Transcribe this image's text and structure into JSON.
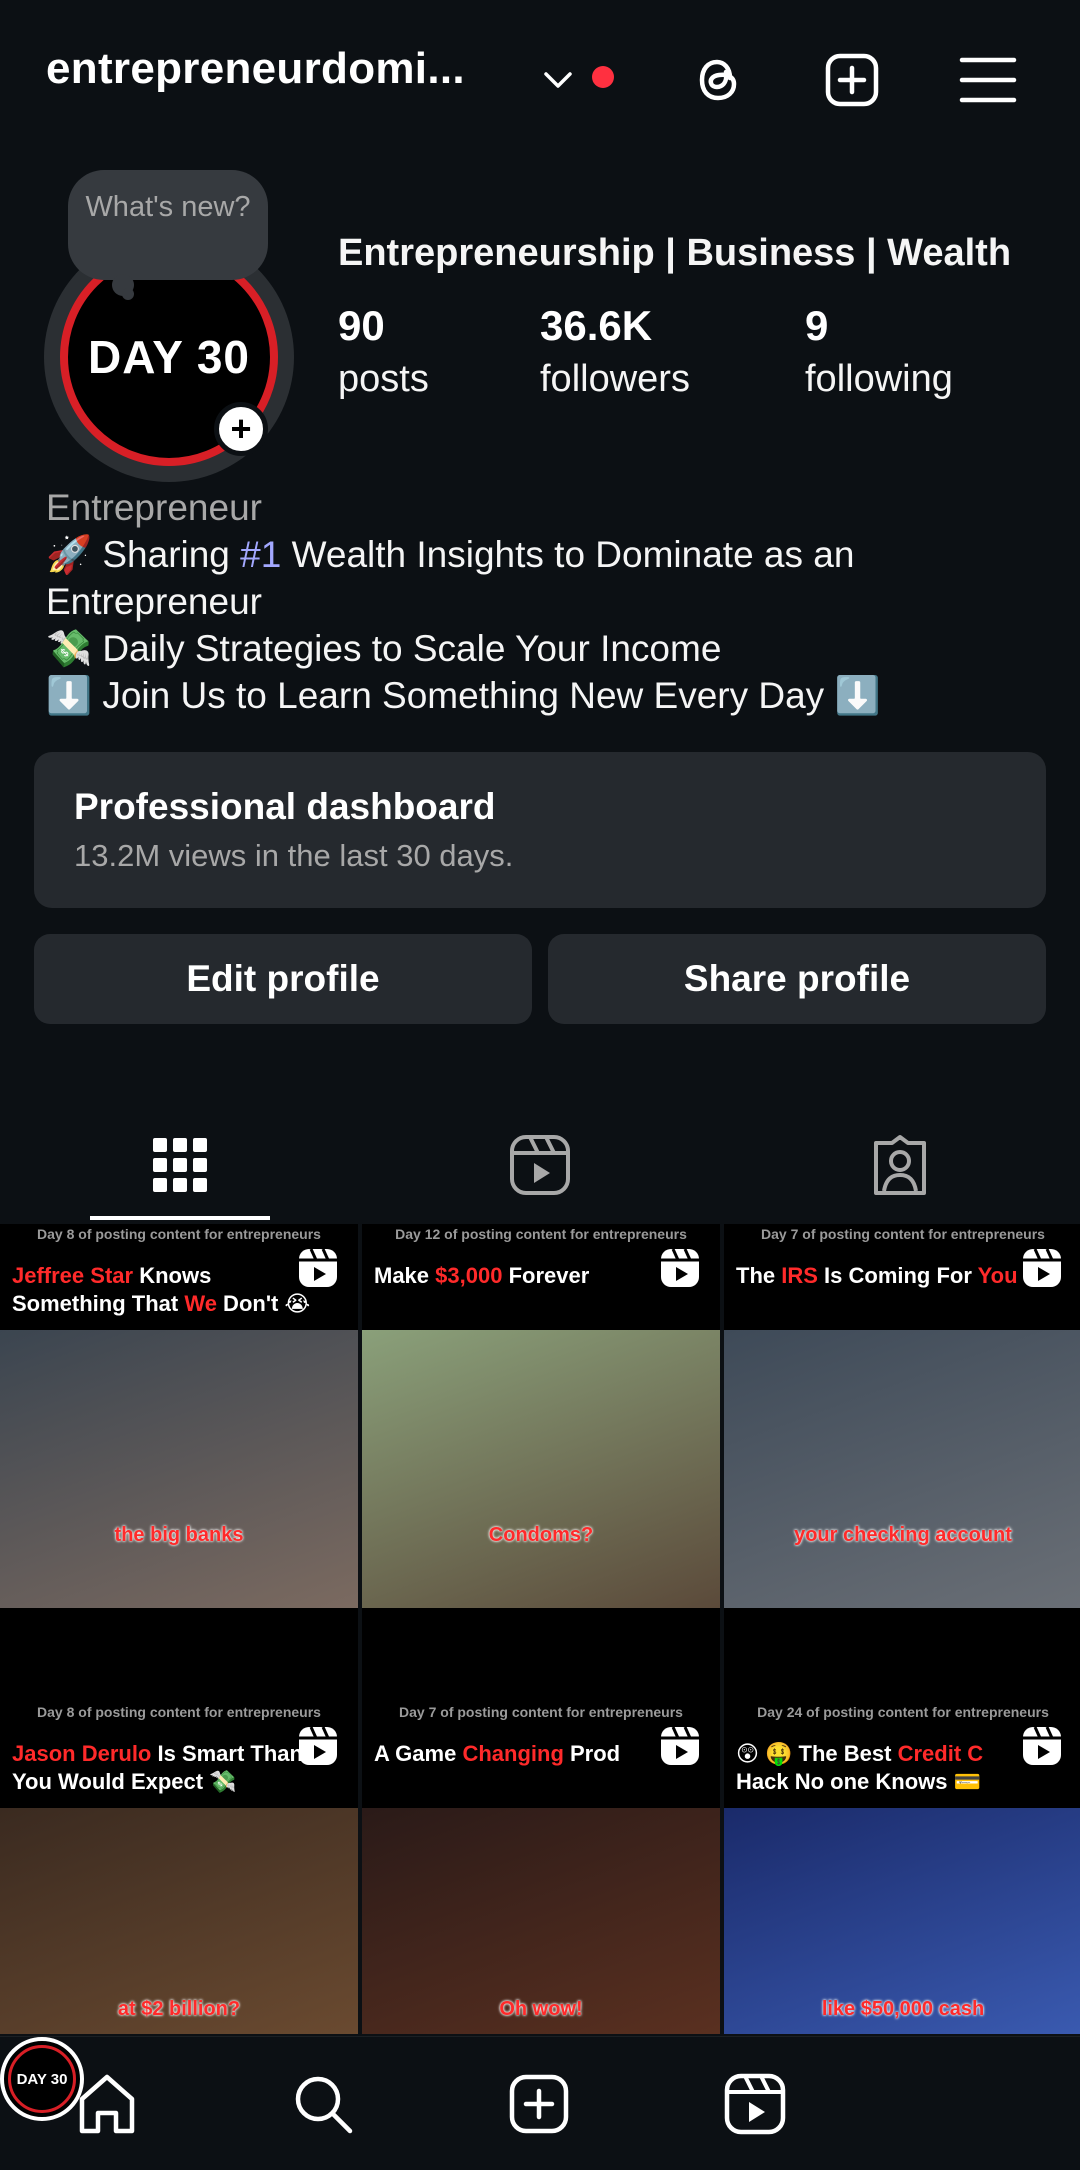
{
  "header": {
    "username": "entrepreneurdomi...",
    "icons": [
      "chevron-down-icon",
      "threads-icon",
      "create-icon",
      "menu-icon"
    ]
  },
  "profile": {
    "note": "What's new?",
    "avatar_text": "DAY 30",
    "category": "Entrepreneurship | Business | Wealth",
    "stats": {
      "posts": {
        "value": "90",
        "label": "posts"
      },
      "followers": {
        "value": "36.6K",
        "label": "followers"
      },
      "following": {
        "value": "9",
        "label": "following"
      }
    },
    "bio": {
      "name": "Entrepreneur",
      "line1_emoji": "🚀",
      "line1_pre": " Sharing ",
      "line1_hashtag": "#1",
      "line1_post": " Wealth Insights to Dominate as an Entrepreneur",
      "line2": "💸 Daily Strategies to Scale Your Income",
      "line3": "⬇️ Join Us to Learn Something New Every Day ⬇️"
    }
  },
  "dashboard": {
    "title": "Professional dashboard",
    "subtitle": "13.2M views in the last 30 days."
  },
  "buttons": {
    "edit": "Edit profile",
    "share": "Share profile"
  },
  "tabs": [
    "grid-icon",
    "reels-icon",
    "tagged-icon"
  ],
  "posts": [
    {
      "top": "Day 8 of posting content for entrepreneurs",
      "title_a": "Jeffree Star",
      "title_b": " Knows Something That ",
      "title_c": "We",
      "title_d": " Don't 😭",
      "caption": "the big banks",
      "colors": [
        "#3b4550",
        "#7b6a60"
      ]
    },
    {
      "top": "Day 12 of posting content for entrepreneurs",
      "title_a": "Make ",
      "title_b": "$3,000",
      "title_c": " Forever",
      "title_d": "",
      "caption": "Condoms?",
      "colors": [
        "#8aa07a",
        "#5b4a3a"
      ]
    },
    {
      "top": "Day 7 of posting content for entrepreneurs",
      "title_a": "The ",
      "title_b": "IRS",
      "title_c": " Is Coming For ",
      "title_d": "You",
      "caption": "your checking account",
      "colors": [
        "#3e4a58",
        "#6a6f76"
      ]
    },
    {
      "top": "Day 8 of posting content for entrepreneurs",
      "title_a": "Jason Derulo",
      "title_b": " Is Smart",
      "title_c": " Than You Would Expect",
      "title_d": " 💸",
      "caption": "at $2 billion?",
      "colors": [
        "#3a2a20",
        "#6a4a30"
      ]
    },
    {
      "top": "Day 7 of posting content for entrepreneurs",
      "title_a": "A Game ",
      "title_b": "Changing",
      "title_c": " Prod",
      "title_d": "",
      "caption": "Oh wow!",
      "colors": [
        "#2a1a18",
        "#5a3020"
      ]
    },
    {
      "top": "Day 24 of posting content for entrepreneurs",
      "title_a": "😲 🤑 The Best ",
      "title_b": "Credit C",
      "title_c": " Hack No one Knows 💳",
      "title_d": "",
      "caption": "like $50,000 cash",
      "colors": [
        "#1a2a6a",
        "#3a5ab0"
      ]
    }
  ],
  "bottom_nav": {
    "items": [
      "home-icon",
      "search-icon",
      "create-icon",
      "reels-icon",
      "profile-avatar"
    ],
    "profile_text": "DAY 30"
  },
  "colors": {
    "background": "#0c1014",
    "card": "#25292e",
    "accent_red": "#ff3040",
    "hashtag": "#a3a8ff"
  }
}
